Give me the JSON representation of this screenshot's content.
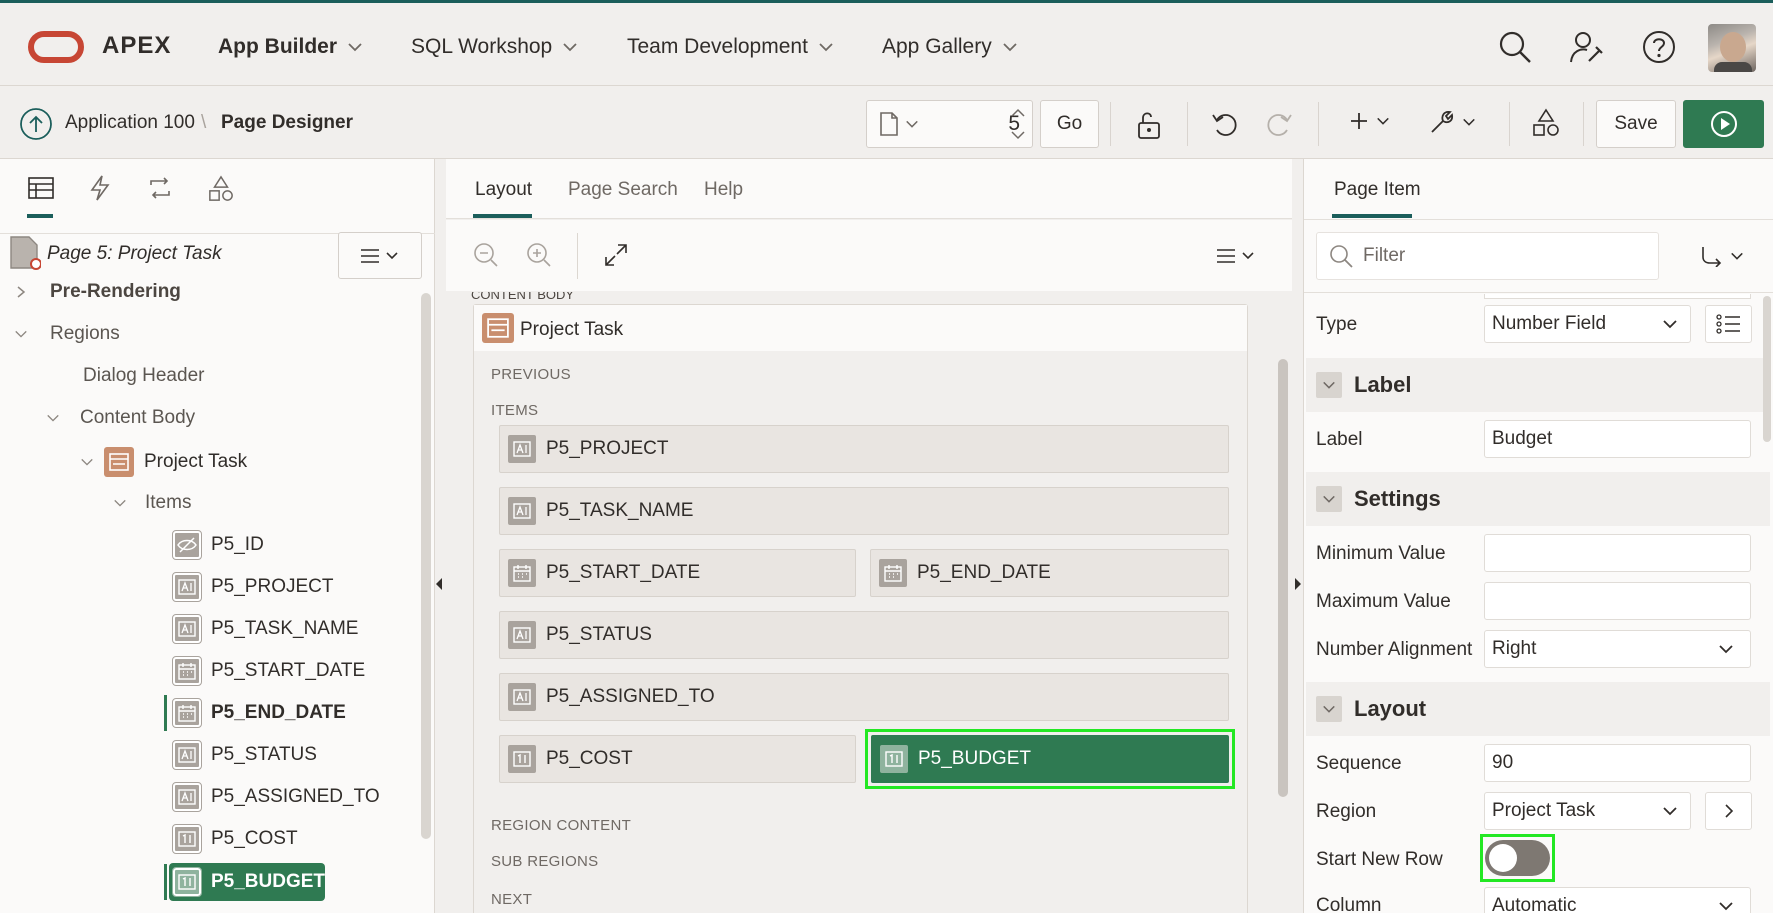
{
  "top_nav": {
    "brand": "APEX",
    "menus": [
      "App Builder",
      "SQL Workshop",
      "Team Development",
      "App Gallery"
    ],
    "icons": [
      "search-icon",
      "user-settings-icon",
      "help-icon"
    ]
  },
  "toolbar": {
    "breadcrumb_app": "Application 100",
    "breadcrumb_sep": "\\",
    "breadcrumb_page": "Page Designer",
    "page_number": "5",
    "go_label": "Go",
    "save_label": "Save"
  },
  "left_pane": {
    "page_title": "Page 5: Project Task",
    "tree": {
      "pre_rendering": "Pre-Rendering",
      "regions": "Regions",
      "dialog_header": "Dialog Header",
      "content_body": "Content Body",
      "project_task": "Project Task",
      "items": "Items",
      "item_list": [
        "P5_ID",
        "P5_PROJECT",
        "P5_TASK_NAME",
        "P5_START_DATE",
        "P5_END_DATE",
        "P5_STATUS",
        "P5_ASSIGNED_TO",
        "P5_COST",
        "P5_BUDGET"
      ]
    }
  },
  "center_pane": {
    "tabs": [
      "Layout",
      "Page Search",
      "Help"
    ],
    "region_label": "CONTENT BODY",
    "region_title": "Project Task",
    "sections": {
      "previous": "PREVIOUS",
      "items": "ITEMS",
      "region_content": "REGION CONTENT",
      "sub_regions": "SUB REGIONS",
      "next": "NEXT"
    },
    "items": [
      "P5_PROJECT",
      "P5_TASK_NAME",
      "P5_START_DATE",
      "P5_END_DATE",
      "P5_STATUS",
      "P5_ASSIGNED_TO",
      "P5_COST",
      "P5_BUDGET"
    ]
  },
  "right_pane": {
    "tab": "Page Item",
    "filter_placeholder": "Filter",
    "type_label": "Type",
    "type_value": "Number Field",
    "groups": {
      "label": "Label",
      "settings": "Settings",
      "layout": "Layout"
    },
    "label_label": "Label",
    "label_value": "Budget",
    "min_label": "Minimum Value",
    "min_value": "",
    "max_label": "Maximum Value",
    "max_value": "",
    "align_label": "Number Alignment",
    "align_value": "Right",
    "sequence_label": "Sequence",
    "sequence_value": "90",
    "region_label": "Region",
    "region_value": "Project Task",
    "start_new_row_label": "Start New Row",
    "start_new_row_on": false,
    "column_label": "Column",
    "column_value": "Automatic"
  },
  "colors": {
    "accent": "#1b5e5b",
    "selected_item": "#2f7a52",
    "highlight_outline": "#23e823",
    "run_button": "#2f7a52",
    "logo": "#c74634"
  }
}
